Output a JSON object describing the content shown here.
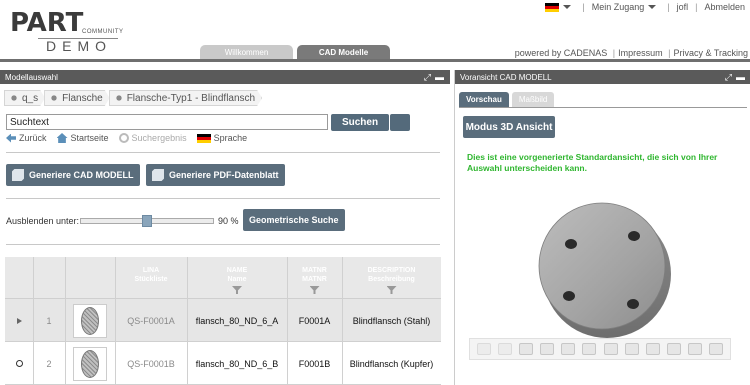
{
  "header": {
    "logo": {
      "part": "PART",
      "community": "COMMUNITY",
      "demo": "DEMO"
    },
    "topnav": {
      "account": "Mein Zugang",
      "user": "jofl",
      "logout": "Abmelden"
    },
    "tabs": [
      {
        "label": "Willkommen"
      },
      {
        "label": "CAD Modelle"
      }
    ],
    "powered": {
      "prefix": "powered by CADENAS",
      "impressum": "Impressum",
      "privacy": "Privacy & Tracking"
    }
  },
  "left": {
    "title": "Modellauswahl",
    "breadcrumb": [
      "q_s",
      "Flansche",
      "Flansche-Typ1 - Blindflansch"
    ],
    "search": {
      "value": "Suchtext",
      "button": "Suchen"
    },
    "nav": {
      "back": "Zurück",
      "home": "Startseite",
      "results": "Suchergebnis",
      "language": "Sprache"
    },
    "buttons": {
      "cad": "Generiere CAD MODELL",
      "pdf": "Generiere PDF-Datenblatt"
    },
    "filter": {
      "label": "Ausblenden unter:",
      "value": "90 %",
      "level": 0.5,
      "geo_button": "Geometrische Suche"
    },
    "table": {
      "columns": [
        {
          "top": "LINA",
          "bottom": "Stückliste"
        },
        {
          "top": "NAME",
          "bottom": "Name"
        },
        {
          "top": "MATNR",
          "bottom": "MATNR"
        },
        {
          "top": "DESCRIPTION",
          "bottom": "Beschreibung"
        }
      ],
      "rows": [
        {
          "index": "1",
          "lina": "QS-F0001A",
          "name": "flansch_80_ND_6_A",
          "matnr": "F0001A",
          "desc": "Blindflansch (Stahl)"
        },
        {
          "index": "2",
          "lina": "QS-F0001B",
          "name": "flansch_80_ND_6_B",
          "matnr": "F0001B",
          "desc": "Blindflansch (Kupfer)"
        }
      ]
    }
  },
  "right": {
    "title": "Voransicht CAD MODELL",
    "tabs": [
      {
        "label": "Vorschau"
      },
      {
        "label": "Maßbild"
      }
    ],
    "mode_button": "Modus 3D Ansicht",
    "info": "Dies ist eine vorgenerierte Standardansicht, die sich von Ihrer Auswahl unterscheiden kann."
  }
}
